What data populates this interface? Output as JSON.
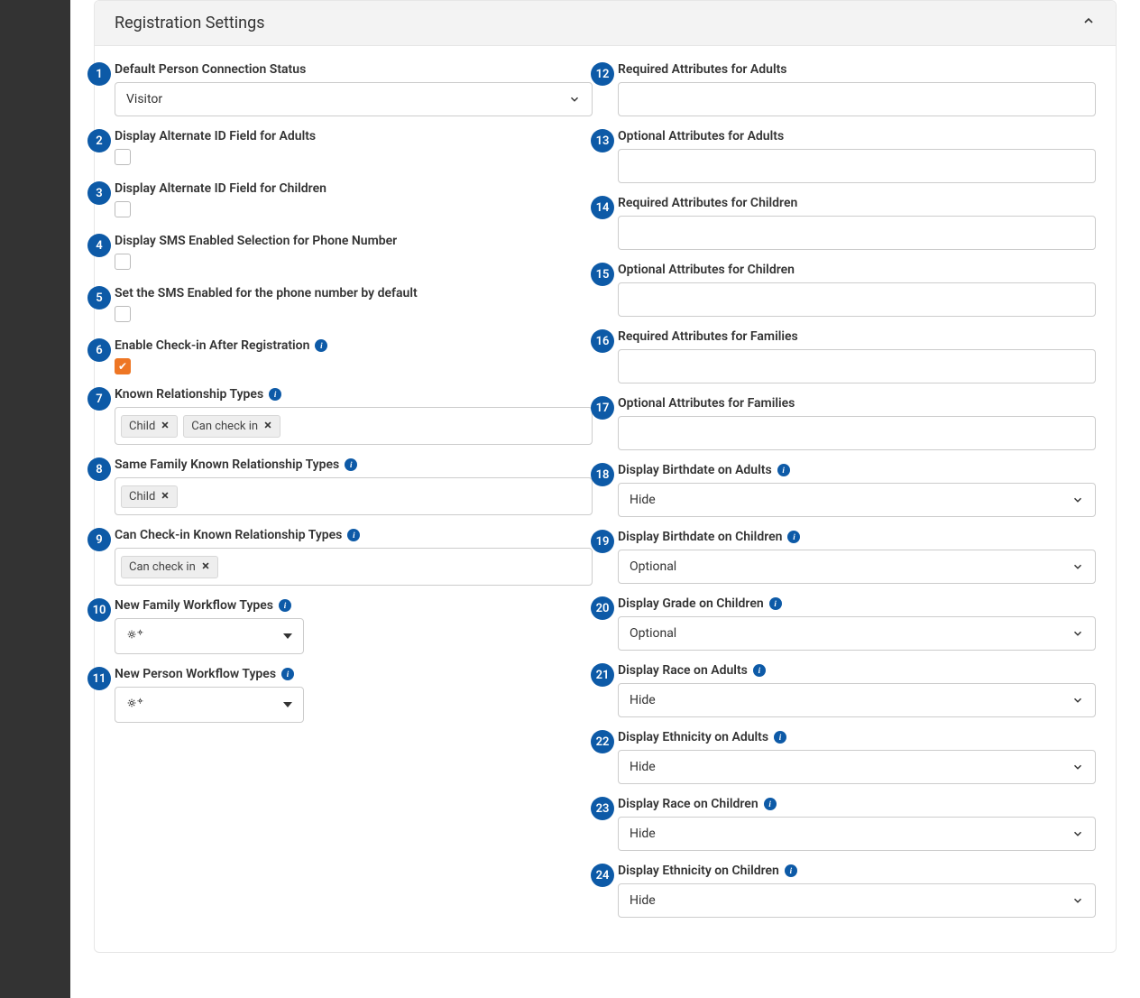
{
  "panel": {
    "title": "Registration Settings"
  },
  "left": [
    {
      "num": 1,
      "label": "Default Person Connection Status",
      "control": "select",
      "value": "Visitor"
    },
    {
      "num": 2,
      "label": "Display Alternate ID Field for Adults",
      "control": "checkbox",
      "checked": false
    },
    {
      "num": 3,
      "label": "Display Alternate ID Field for Children",
      "control": "checkbox",
      "checked": false
    },
    {
      "num": 4,
      "label": "Display SMS Enabled Selection for Phone Number",
      "control": "checkbox",
      "checked": false
    },
    {
      "num": 5,
      "label": "Set the SMS Enabled for the phone number by default",
      "control": "checkbox",
      "checked": false
    },
    {
      "num": 6,
      "label": "Enable Check-in After Registration",
      "control": "checkbox",
      "checked": true,
      "info": true
    },
    {
      "num": 7,
      "label": "Known Relationship Types",
      "control": "tags",
      "info": true,
      "tags": [
        "Child",
        "Can check in"
      ]
    },
    {
      "num": 8,
      "label": "Same Family Known Relationship Types",
      "control": "tags",
      "info": true,
      "tags": [
        "Child"
      ]
    },
    {
      "num": 9,
      "label": "Can Check-in Known Relationship Types",
      "control": "tags",
      "info": true,
      "tags": [
        "Can check in"
      ]
    },
    {
      "num": 10,
      "label": "New Family Workflow Types",
      "control": "wfpicker",
      "info": true
    },
    {
      "num": 11,
      "label": "New Person Workflow Types",
      "control": "wfpicker",
      "info": true
    }
  ],
  "right": [
    {
      "num": 12,
      "label": "Required Attributes for Adults",
      "control": "textbox"
    },
    {
      "num": 13,
      "label": "Optional Attributes for Adults",
      "control": "textbox"
    },
    {
      "num": 14,
      "label": "Required Attributes for Children",
      "control": "textbox"
    },
    {
      "num": 15,
      "label": "Optional Attributes for Children",
      "control": "textbox"
    },
    {
      "num": 16,
      "label": "Required Attributes for Families",
      "control": "textbox"
    },
    {
      "num": 17,
      "label": "Optional Attributes for Families",
      "control": "textbox"
    },
    {
      "num": 18,
      "label": "Display Birthdate on Adults",
      "control": "select",
      "info": true,
      "value": "Hide"
    },
    {
      "num": 19,
      "label": "Display Birthdate on Children",
      "control": "select",
      "info": true,
      "value": "Optional"
    },
    {
      "num": 20,
      "label": "Display Grade on Children",
      "control": "select",
      "info": true,
      "value": "Optional"
    },
    {
      "num": 21,
      "label": "Display Race on Adults",
      "control": "select",
      "info": true,
      "value": "Hide"
    },
    {
      "num": 22,
      "label": "Display Ethnicity on Adults",
      "control": "select",
      "info": true,
      "value": "Hide"
    },
    {
      "num": 23,
      "label": "Display Race on Children",
      "control": "select",
      "info": true,
      "value": "Hide"
    },
    {
      "num": 24,
      "label": "Display Ethnicity on Children",
      "control": "select",
      "info": true,
      "value": "Hide"
    }
  ]
}
